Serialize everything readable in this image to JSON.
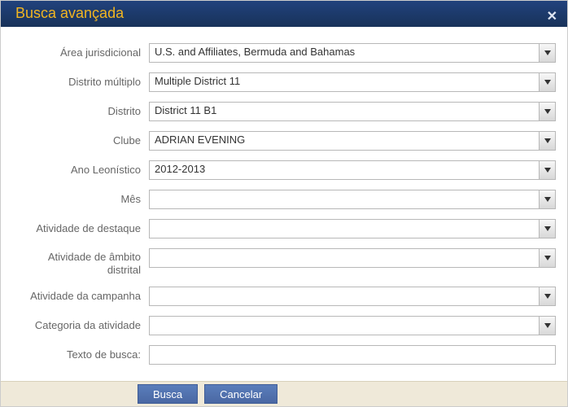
{
  "dialog": {
    "title": "Busca avançada"
  },
  "labels": {
    "area": "Área jurisdicional",
    "md": "Distrito múltiplo",
    "district": "Distrito",
    "club": "Clube",
    "fy": "Ano Leonístico",
    "month": "Mês",
    "signature": "Atividade de destaque",
    "dwa": "Atividade de âmbito distrital",
    "campaign": "Atividade da campanha",
    "category": "Categoria da atividade",
    "search_text": "Texto de busca:"
  },
  "values": {
    "area": "U.S. and Affiliates, Bermuda and Bahamas",
    "md": "Multiple District 11",
    "district": "District 11 B1",
    "club": "ADRIAN EVENING",
    "fy": "2012-2013",
    "month": "",
    "signature": "",
    "dwa": "",
    "campaign": "",
    "category": "",
    "search_text": ""
  },
  "buttons": {
    "search": "Busca",
    "cancel": "Cancelar"
  }
}
